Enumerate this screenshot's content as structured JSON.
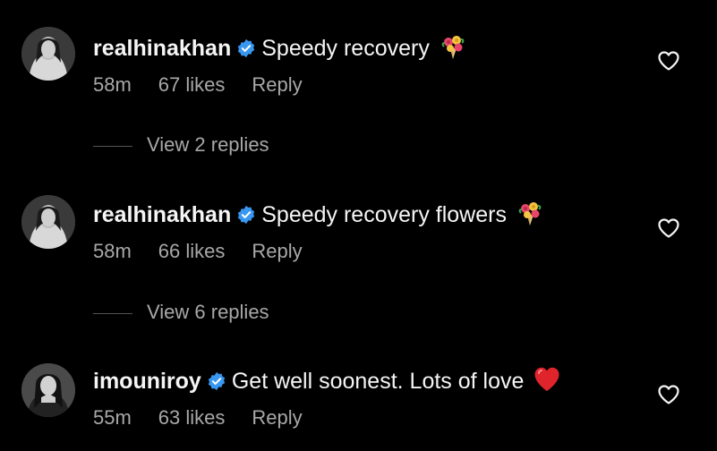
{
  "comments": [
    {
      "username": "realhinakhan",
      "text": "Speedy recovery",
      "emoji": "flower-bouquet-icon",
      "time": "58m",
      "likes": "67 likes",
      "reply": "Reply",
      "view_replies": "View 2 replies"
    },
    {
      "username": "realhinakhan",
      "text": "Speedy recovery flowers",
      "emoji": "flower-bouquet-icon",
      "time": "58m",
      "likes": "66 likes",
      "reply": "Reply",
      "view_replies": "View 6 replies"
    },
    {
      "username": "imouniroy",
      "text": "Get well soonest. Lots of love",
      "emoji": "red-heart-icon",
      "time": "55m",
      "likes": "63 likes",
      "reply": "Reply"
    }
  ],
  "colors": {
    "background": "#000000",
    "primary_text": "#f5f5f5",
    "secondary_text": "#a8a8a8",
    "verified_blue": "#3897f0",
    "heart_red": "#e0242b"
  }
}
